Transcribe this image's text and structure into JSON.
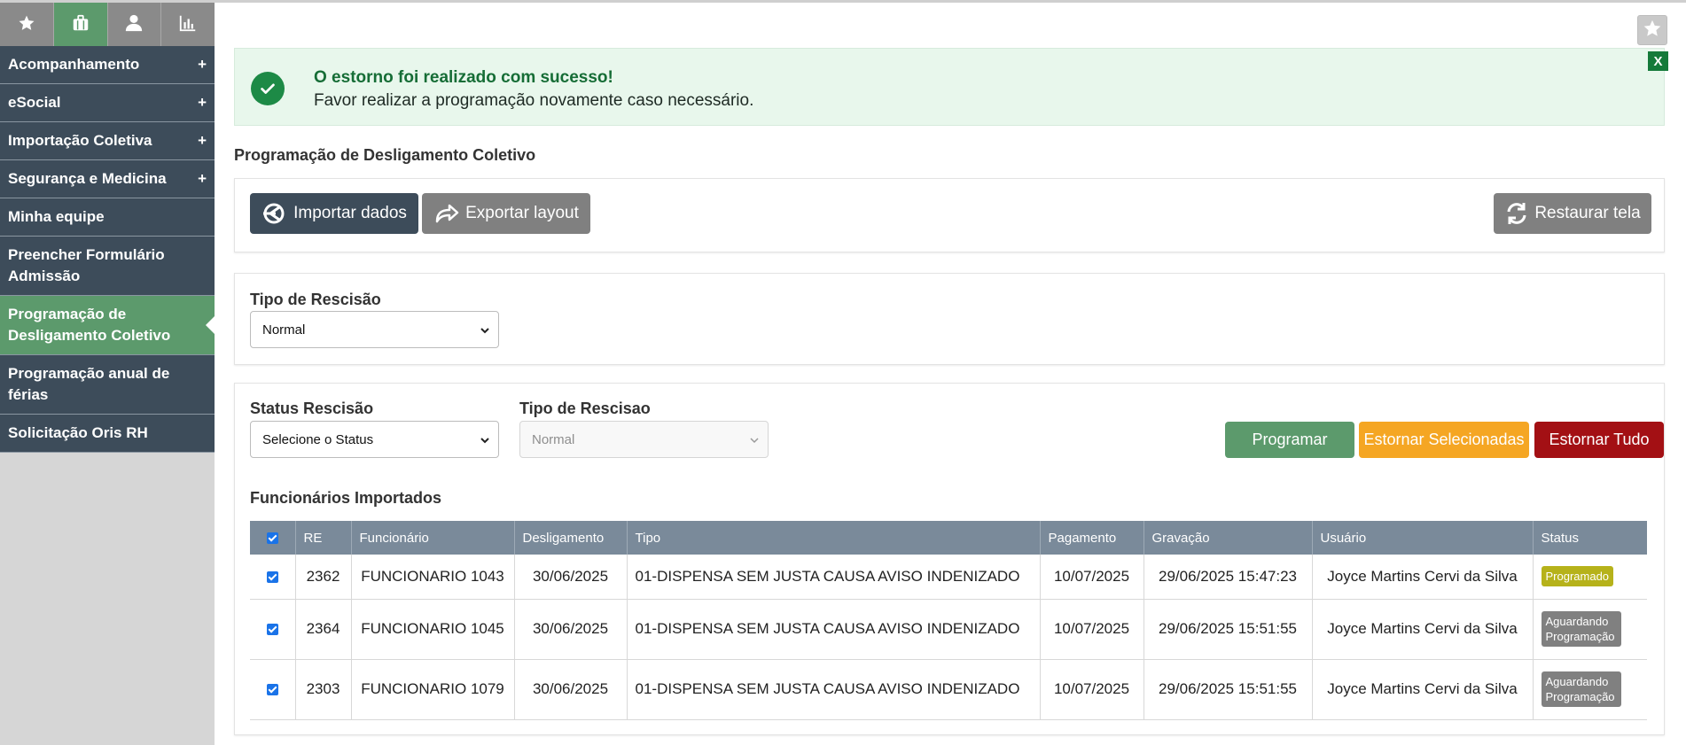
{
  "sidebar": {
    "tabs": [
      {
        "icon": "star-icon",
        "active": false
      },
      {
        "icon": "briefcase-icon",
        "active": true
      },
      {
        "icon": "user-icon",
        "active": false
      },
      {
        "icon": "bar-chart-icon",
        "active": false
      }
    ],
    "items": [
      {
        "label": "Acompanhamento",
        "expandable": true
      },
      {
        "label": "eSocial",
        "expandable": true
      },
      {
        "label": "Importação Coletiva",
        "expandable": true
      },
      {
        "label": "Segurança e Medicina",
        "expandable": true
      },
      {
        "label": "Minha equipe",
        "expandable": false
      },
      {
        "label": "Preencher Formulário Admissão",
        "expandable": false
      },
      {
        "label": "Programação de Desligamento Coletivo",
        "expandable": false,
        "active": true
      },
      {
        "label": "Programação anual de férias",
        "expandable": false
      },
      {
        "label": "Solicitação Oris RH",
        "expandable": false
      }
    ],
    "plus_symbol": "+"
  },
  "alert": {
    "title": "O estorno foi realizado com sucesso!",
    "message": "Favor realizar a programação novamente caso necessário.",
    "close_label": "X",
    "color": "#1d8a46"
  },
  "page": {
    "title": "Programação de Desligamento Coletivo"
  },
  "toolbar": {
    "import_label": "Importar dados",
    "export_label": "Exportar layout",
    "restore_label": "Restaurar tela"
  },
  "filters": {
    "tipo_rescisao_label": "Tipo de Rescisão",
    "tipo_rescisao_value": "Normal",
    "status_label": "Status Rescisão",
    "status_value": "Selecione o Status",
    "tipo_rescisao2_label": "Tipo de Rescisao",
    "tipo_rescisao2_value": "Normal"
  },
  "actions": {
    "programar": "Programar",
    "estornar_selecionadas": "Estornar Selecionadas",
    "estornar_tudo": "Estornar Tudo",
    "colors": {
      "programar": "#5c9a6c",
      "estornar_selecionadas": "#f5a623",
      "estornar_tudo": "#a31014"
    }
  },
  "table": {
    "section_title": "Funcionários Importados",
    "headers": [
      "RE",
      "Funcionário",
      "Desligamento",
      "Tipo",
      "Pagamento",
      "Gravação",
      "Usuário",
      "Status"
    ],
    "rows": [
      {
        "checked": true,
        "re": "2362",
        "funcionario": "FUNCIONARIO 1043",
        "desligamento": "30/06/2025",
        "tipo": "01-DISPENSA SEM JUSTA CAUSA AVISO INDENIZADO",
        "pagamento": "10/07/2025",
        "gravacao": "29/06/2025 15:47:23",
        "usuario": "Joyce Martins Cervi da Silva",
        "status": "Programado",
        "status_kind": "green"
      },
      {
        "checked": true,
        "re": "2364",
        "funcionario": "FUNCIONARIO 1045",
        "desligamento": "30/06/2025",
        "tipo": "01-DISPENSA SEM JUSTA CAUSA AVISO INDENIZADO",
        "pagamento": "10/07/2025",
        "gravacao": "29/06/2025 15:51:55",
        "usuario": "Joyce Martins Cervi da Silva",
        "status": "Aguardando Programação",
        "status_kind": "gray"
      },
      {
        "checked": true,
        "re": "2303",
        "funcionario": "FUNCIONARIO 1079",
        "desligamento": "30/06/2025",
        "tipo": "01-DISPENSA SEM JUSTA CAUSA AVISO INDENIZADO",
        "pagamento": "10/07/2025",
        "gravacao": "29/06/2025 15:51:55",
        "usuario": "Joyce Martins Cervi da Silva",
        "status": "Aguardando Programação",
        "status_kind": "gray"
      }
    ]
  }
}
